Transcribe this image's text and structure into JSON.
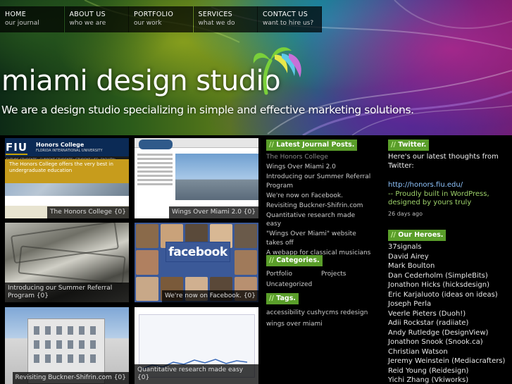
{
  "nav": [
    {
      "title": "HOME",
      "sub": "our journal"
    },
    {
      "title": "ABOUT US",
      "sub": "who we are"
    },
    {
      "title": "PORTFOLIO",
      "sub": "our work"
    },
    {
      "title": "SERVICES",
      "sub": "what we do"
    },
    {
      "title": "CONTACT US",
      "sub": "want to hire us?"
    }
  ],
  "brand": {
    "name": "miami design studio",
    "tagline": "We are a design studio specializing in simple and effective marketing solutions."
  },
  "portfolio": [
    {
      "caption": "The Honors College {0}"
    },
    {
      "caption": "Wings Over Miami 2.0 {0}"
    },
    {
      "caption": "Introducing our Summer Referral Program {0}"
    },
    {
      "caption": "We're now on Facebook. {0}"
    },
    {
      "caption": "Revisiting Buckner-Shifrin.com {0}"
    },
    {
      "caption": "Quantitative research made easy {0}"
    }
  ],
  "thumb_text": {
    "fiu": "FIU",
    "honors_college": "Honors College",
    "university": "FLORIDA INTERNATIONAL UNIVERSITY",
    "nav": "FUTURE STUDENTS▾   CURRENT STUDENTS▾   STUDENT LIFE▾   FACULTY▾",
    "ribbon_1": "The Honors College offers the very best in",
    "ribbon_2": "undergraduate education",
    "facebook": "facebook"
  },
  "journal": {
    "title_slash": "//",
    "title": "Latest Journal Posts.",
    "posts": [
      "The Honors College",
      "Wings Over Miami 2.0",
      "Introducing our Summer Referral Program",
      "We're now on Facebook.",
      "Revisiting Buckner-Shifrin.com",
      "Quantitative research made easy",
      "\"Wings Over Miami\" website takes off",
      "A webapp for classical musicians"
    ]
  },
  "categories": {
    "title_slash": "//",
    "title": "Categories.",
    "items": [
      "Portfolio",
      "Projects",
      "Uncategorized"
    ]
  },
  "tags": {
    "title_slash": "//",
    "title": "Tags.",
    "line1": "accessibility cushycms redesign",
    "line2": "wings over miami"
  },
  "twitter": {
    "title_slash": "//",
    "title": "Twitter.",
    "intro": "Here's our latest thoughts from Twitter:",
    "link": "http://honors.fiu.edu/",
    "body": "-- Proudly built in WordPress, designed by yours truly",
    "ago": "26 days ago"
  },
  "heroes": {
    "title_slash": "//",
    "title": "Our Heroes.",
    "items": [
      "37signals",
      "David Airey",
      "Mark Boulton",
      "Dan Cederholm (SimpleBits)",
      "Jonathon Hicks (hicksdesign)",
      "Eric Karjaluoto (ideas on ideas)",
      "Joseph Perla",
      "Veerle Pieters (Duoh!)",
      "Adii Rockstar (radiiate)",
      "Andy Rutledge (DesignView)",
      "Jonathon Snook (Snook.ca)",
      "Christian Watson",
      "Jeremy Weinstein (Mediacrafters)",
      "Reid Young (Reidesign)",
      "Yichi Zhang (Vkiworks)"
    ]
  },
  "colors": {
    "section_bar": "#5a9e2a",
    "twitter_link": "#8fc5ff",
    "twitter_body": "#9ed26a"
  }
}
